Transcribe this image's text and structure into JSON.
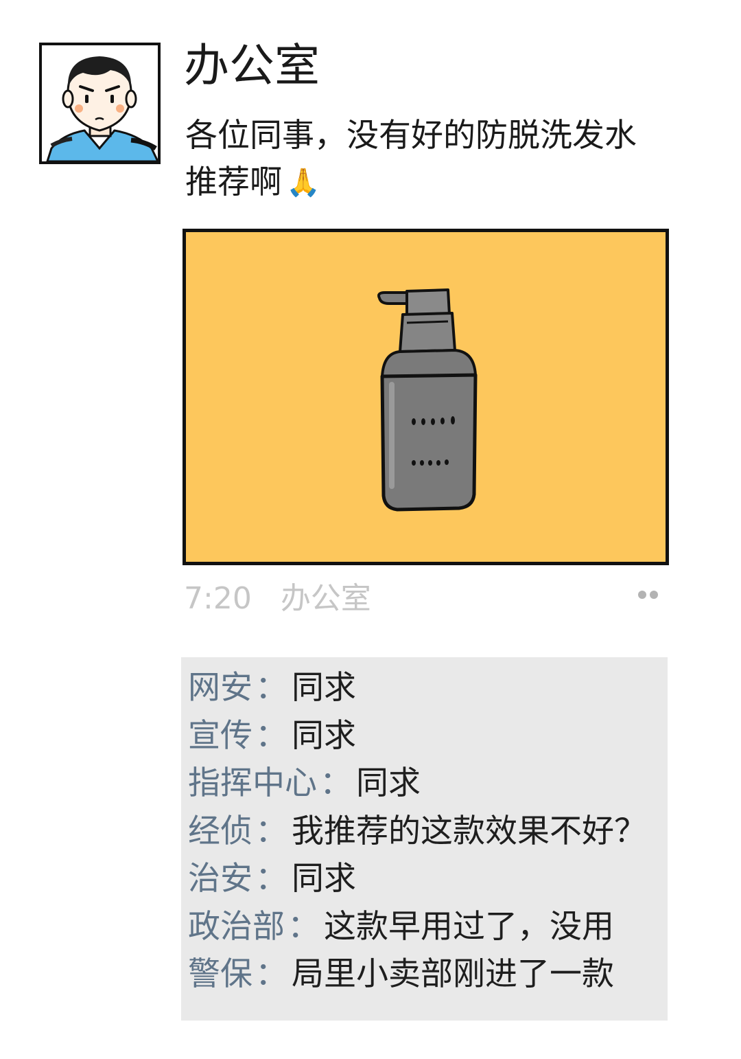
{
  "post": {
    "author": "办公室",
    "text_line1": "各位同事，没有好的防脱洗发水",
    "text_line2": "推荐啊",
    "emoji": "🙏",
    "time": "7:20",
    "source": "办公室",
    "more_icon": "ellipsis-icon"
  },
  "colors": {
    "image_background": "#fdc75c",
    "bottle": "#7a7a7a",
    "comment_author": "#5f7489",
    "comment_background": "#e9e9e9",
    "meta_text": "#c6c6c6"
  },
  "comments": [
    {
      "author": "网安",
      "sep": "：",
      "text": "同求"
    },
    {
      "author": "宣传",
      "sep": "：",
      "text": "同求"
    },
    {
      "author": "指挥中心",
      "sep": "：",
      "text": "同求"
    },
    {
      "author": "经侦",
      "sep": "：",
      "text": "我推荐的这款效果不好？"
    },
    {
      "author": "治安",
      "sep": "：",
      "text": "同求"
    },
    {
      "author": "政治部",
      "sep": "：",
      "text": "这款早用过了，没用"
    },
    {
      "author": "警保",
      "sep": "：",
      "text": "局里小卖部刚进了一款"
    }
  ]
}
